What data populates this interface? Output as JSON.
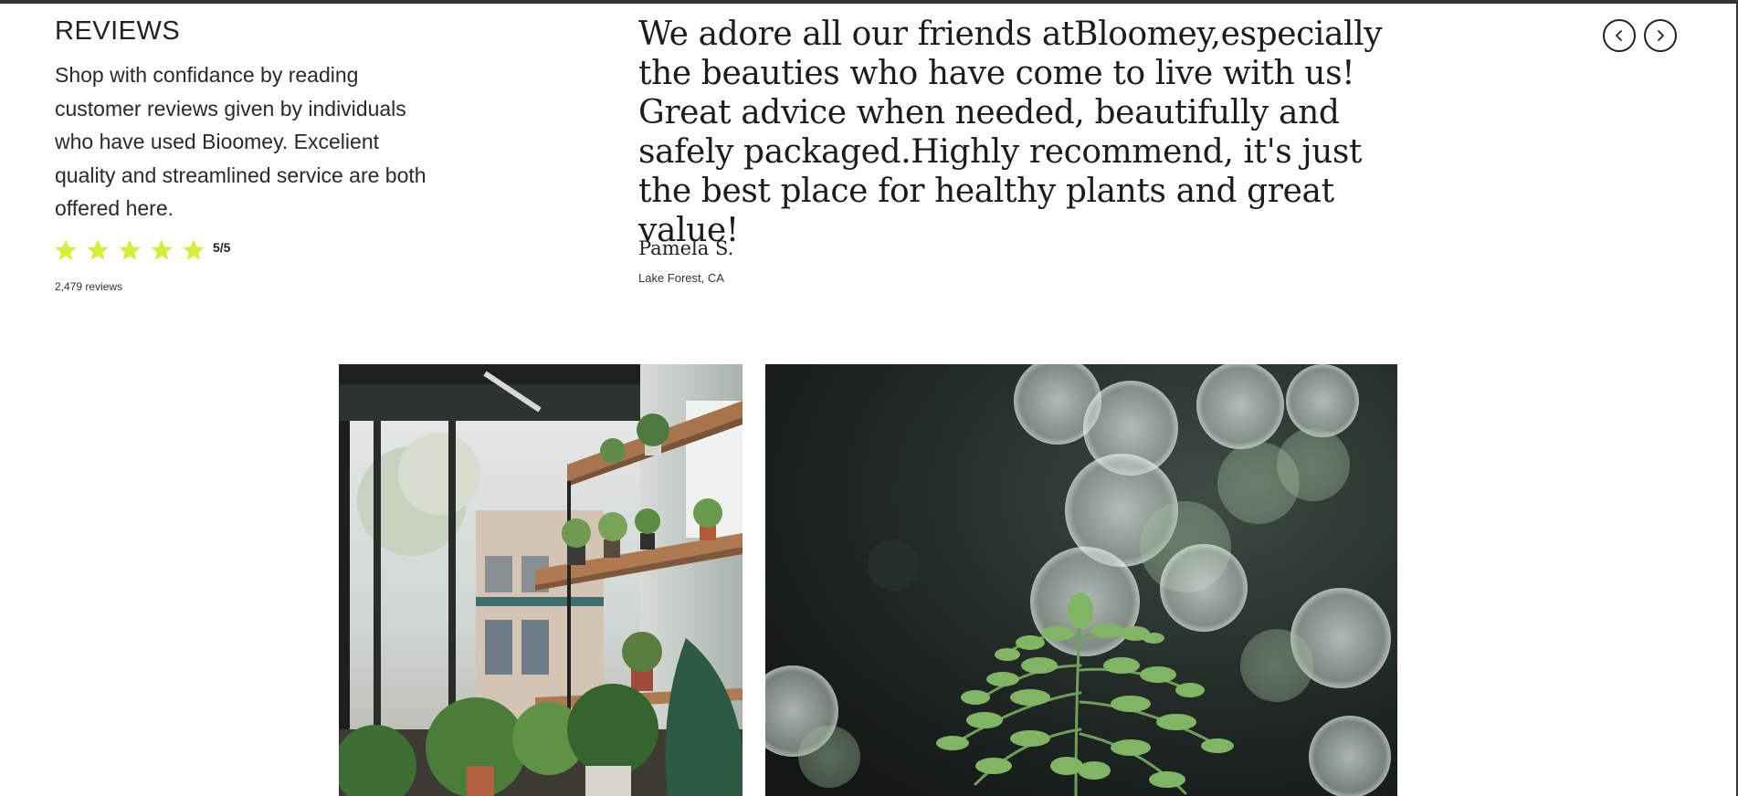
{
  "reviews": {
    "title": "REVIEWS",
    "description": "Shop with confidance by reading customer reviews given by individuals who have used Bioomey. Excelient quality and streamlined service are both offered here.",
    "rating": 5,
    "rating_max": 5,
    "rating_text": "5/5",
    "count_text": "2,479 reviews",
    "star_color": "#d9ec3e"
  },
  "testimonial": {
    "quote": "We adore all our friends atBloomey,especially the beauties who have come to live with us! Great advice when needed, beautifully and safely packaged.Highly recommend, it's just the best place for healthy plants and great value!",
    "author": "Pamela S.",
    "location": "Lake Forest, CA"
  },
  "navigation": {
    "prev_icon": "chevron-left-icon",
    "next_icon": "chevron-right-icon"
  },
  "gallery": {
    "images": [
      {
        "subject": "plant-shop-shelves-photo"
      },
      {
        "subject": "fern-bokeh-photo"
      }
    ]
  }
}
